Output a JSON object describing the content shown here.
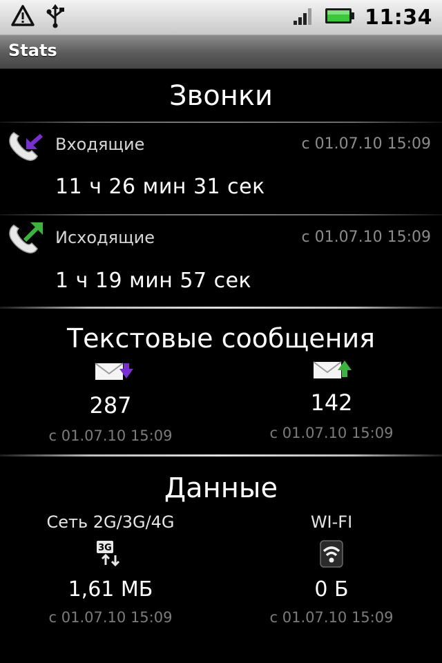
{
  "status_bar": {
    "icons": [
      "warning-triangle-icon",
      "usb-icon",
      "signal-icon",
      "battery-icon"
    ],
    "time": "11:34"
  },
  "title_bar": {
    "title": "Stats"
  },
  "calls": {
    "title": "Звонки",
    "incoming": {
      "label": "Входящие",
      "since": "с 01.07.10 15:09",
      "value": "11 ч 26 мин 31 сек",
      "icon": "incoming-call-icon"
    },
    "outgoing": {
      "label": "Исходящие",
      "since": "с 01.07.10 15:09",
      "value": "1 ч 19 мин 57 сек",
      "icon": "outgoing-call-icon"
    }
  },
  "messages": {
    "title": "Текстовые сообщения",
    "received": {
      "icon": "received-message-icon",
      "count": "287",
      "since": "с 01.07.10 15:09"
    },
    "sent": {
      "icon": "sent-message-icon",
      "count": "142",
      "since": "с 01.07.10 15:09"
    }
  },
  "data": {
    "title": "Данные",
    "mobile": {
      "label": "Сеть 2G/3G/4G",
      "icon": "3g-data-icon",
      "value": "1,61 МБ",
      "since": "с 01.07.10 15:09"
    },
    "wifi": {
      "label": "WI-FI",
      "icon": "wifi-icon",
      "value": "0 Б",
      "since": "с 01.07.10 15:09"
    }
  },
  "colors": {
    "incoming_accent": "#7a2fd0",
    "outgoing_accent": "#3cb33c"
  }
}
